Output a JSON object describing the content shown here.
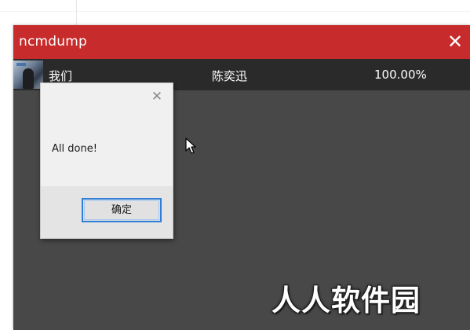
{
  "window": {
    "title": "ncmdump",
    "close_glyph": "✕",
    "titlebar_color": "#c72b2b",
    "body_color": "#484848"
  },
  "track": {
    "name": "我们",
    "artist": "陈奕迅",
    "progress": "100.00%",
    "cover_icon": "album-cover"
  },
  "dialog": {
    "close_glyph": "✕",
    "message": "All done!",
    "ok_label": "确定",
    "accent": "#2f7ed8"
  },
  "watermark": {
    "text": "人人软件园"
  }
}
